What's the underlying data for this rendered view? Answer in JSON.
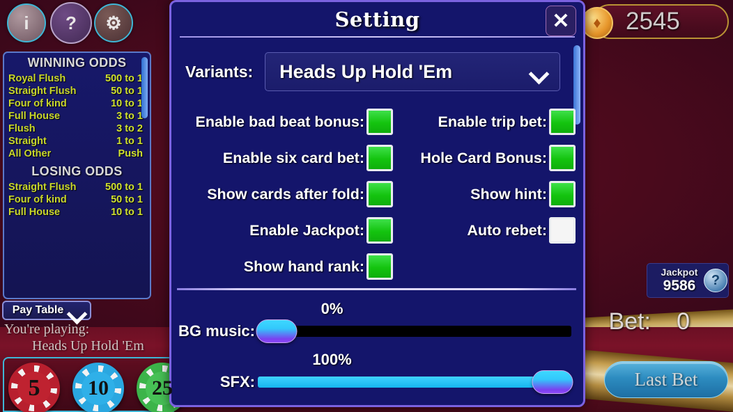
{
  "app": {
    "balance": "2545",
    "bet_label": "Bet:",
    "bet_value": "0",
    "last_bet_button": "Last Bet",
    "playing_prefix": "You're playing:",
    "playing_variant": "Heads Up Hold 'Em",
    "pay_table_label": "Pay Table",
    "jackpot_label": "Jackpot",
    "jackpot_value": "9586",
    "jackpot_help_glyph": "?",
    "coin_glyph": "♦",
    "top_buttons": [
      {
        "name": "info",
        "glyph": "i"
      },
      {
        "name": "help-cards",
        "glyph": "?"
      },
      {
        "name": "settings",
        "glyph": "⚙"
      }
    ],
    "chips": [
      {
        "value": "5",
        "color": "#b81f2e"
      },
      {
        "value": "10",
        "color": "#2aa7e0"
      },
      {
        "value": "25",
        "color": "#3cb44a"
      }
    ]
  },
  "odds_panel": {
    "winning_header": "WINNING ODDS",
    "winning_rows": [
      {
        "hand": "Royal Flush",
        "odds": "500 to 1"
      },
      {
        "hand": "Straight Flush",
        "odds": "50 to 1"
      },
      {
        "hand": "Four of kind",
        "odds": "10 to 1"
      },
      {
        "hand": "Full House",
        "odds": "3 to 1"
      },
      {
        "hand": "Flush",
        "odds": "3 to 2"
      },
      {
        "hand": "Straight",
        "odds": "1 to 1"
      },
      {
        "hand": "All Other",
        "odds": "Push"
      }
    ],
    "losing_header": "LOSING ODDS",
    "losing_rows": [
      {
        "hand": "Straight Flush",
        "odds": "500 to 1"
      },
      {
        "hand": "Four of kind",
        "odds": "50 to 1"
      },
      {
        "hand": "Full House",
        "odds": "10 to 1"
      }
    ]
  },
  "dialog": {
    "title": "Setting",
    "close_glyph": "✕",
    "variants_label": "Variants:",
    "variants_value": "Heads Up Hold 'Em",
    "checkboxes_left": [
      {
        "label": "Enable bad beat bonus:",
        "checked": true
      },
      {
        "label": "Enable six card bet:",
        "checked": true
      },
      {
        "label": "Show cards after fold:",
        "checked": true
      },
      {
        "label": "Enable Jackpot:",
        "checked": true
      },
      {
        "label": "Show hand rank:",
        "checked": true
      }
    ],
    "checkboxes_right": [
      {
        "label": "Enable trip bet:",
        "checked": true
      },
      {
        "label": "Hole Card Bonus:",
        "checked": true
      },
      {
        "label": "Show hint:",
        "checked": true
      },
      {
        "label": "Auto rebet:",
        "checked": false
      }
    ],
    "sliders": [
      {
        "name": "BG music:",
        "percent_label": "0%",
        "percent": 0
      },
      {
        "name": "SFX:",
        "percent_label": "100%",
        "percent": 100
      }
    ]
  },
  "colors": {
    "dialog_bg": "#14156b",
    "dialog_border": "#7b62e0",
    "checkbox_on": "#14c40f",
    "slider_fill": "#28c4f5",
    "accent_gold": "#c8d62c",
    "table_bg": "#4a0a1c"
  }
}
